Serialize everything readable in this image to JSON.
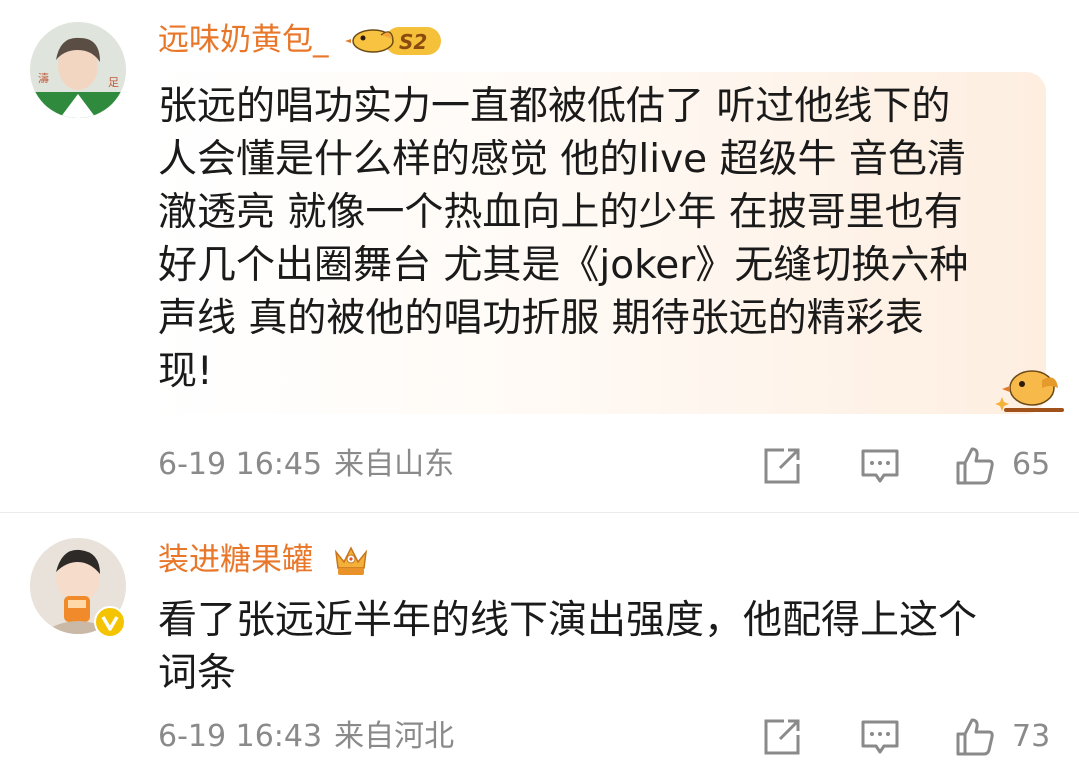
{
  "comments": [
    {
      "username": "远味奶黄包_",
      "badge_icon": "bird-level-badge-icon",
      "badge_text": "S2",
      "content_lines": [
        "张远的唱功实力一直都被低估了 听过他线下的",
        "人会懂是什么样的感觉 他的live 超级牛 音色清",
        "澈透亮 就像一个热血向上的少年 在披哥里也有",
        "好几个出圈舞台 尤其是《joker》无缝切换六种",
        "声线 真的被他的唱功折服  期待张远的精彩表",
        "现!"
      ],
      "date": "6-19 16:45",
      "location": "来自山东",
      "likes": "65"
    },
    {
      "username": "装进糖果罐",
      "badge_icon": "crown-badge-icon",
      "content_lines": [
        "看了张远近半年的线下演出强度，他配得上这个",
        "词条"
      ],
      "date": "6-19 16:43",
      "location": "来自河北",
      "likes": "73"
    }
  ],
  "colors": {
    "username": "#e8772a",
    "meta": "#8a8a8a",
    "text": "#1a1a1a",
    "bubble_tint": "#fdeee0",
    "verified": "#f5c400"
  }
}
